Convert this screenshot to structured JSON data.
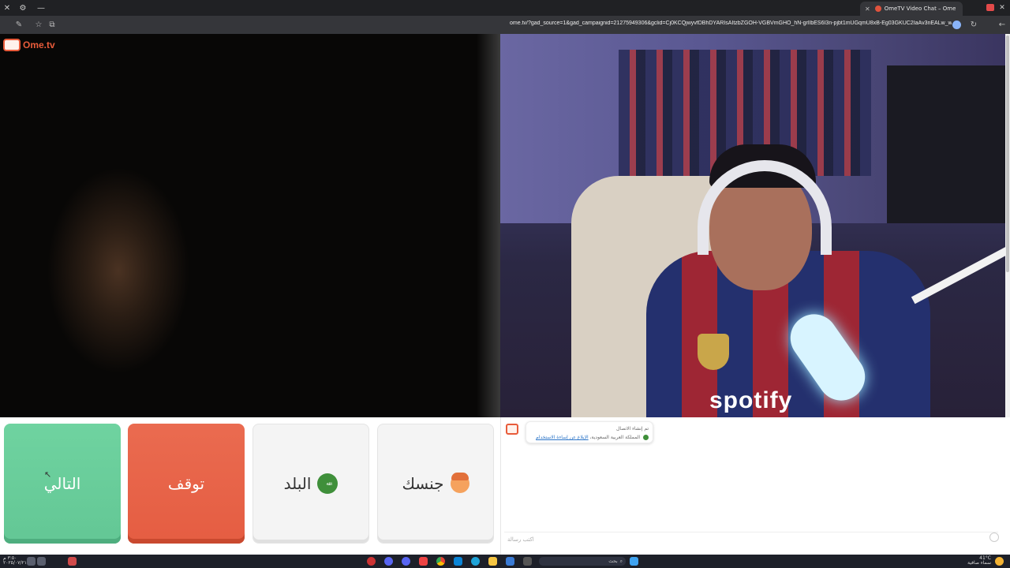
{
  "browser": {
    "tab_title": "OmeTV Video Chat – Ome",
    "url": "ome.tv/?gad_source=1&gad_campaignid=21275949306&gclid=Cj0KCQjwyvfDBhDYARIsAItzbZGOH-VGBVmGHO_hN-grlIbES6I3n-pjbt1mUGqmU8xB-Eg03GKUC2IaAv3nEALw_wcB",
    "close_glyph": "✕",
    "new_tab_glyph": "+",
    "minimize_glyph": "—",
    "window_close_glyph": "✕"
  },
  "page": {
    "logo_text": "Ome.tv",
    "buttons": {
      "next": "التالي",
      "stop": "توقف",
      "country": "البلد",
      "gender": "جنسك"
    },
    "remote_video_text": "spotify",
    "chat": {
      "system_line1": "تم إنشاء الاتصال",
      "system_line2_prefix": "المملكة العربية السعودية",
      "system_link": "الإبلاغ عن إساءة الاستخدام",
      "input_placeholder": "اكتب رسالة"
    }
  },
  "taskbar": {
    "time_left_line1": "٣:٥٠ م",
    "time_left_line2": "٢٠٢٥/٠٧/٢١",
    "search_label": "بحث",
    "weather_temp": "41°C",
    "weather_desc": "سماء صافية"
  },
  "colors": {
    "next": "#6fd3a0",
    "stop": "#ea6b50",
    "brand": "#e85b3a"
  },
  "icons": {
    "country_flag": "saudi-flag-icon",
    "gender": "boy-emoji-icon"
  }
}
